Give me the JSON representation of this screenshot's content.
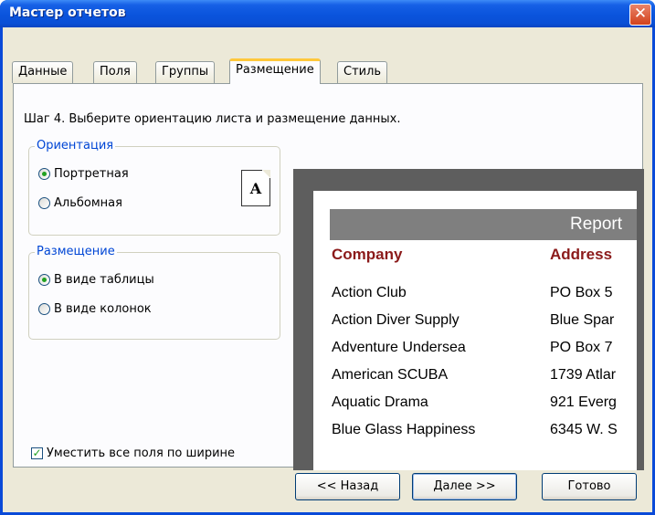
{
  "window": {
    "title": "Мастер отчетов",
    "close_symbol": "✕"
  },
  "tabs": [
    "Данные",
    "Поля",
    "Группы",
    "Размещение",
    "Стиль"
  ],
  "active_tab": "Размещение",
  "step_text": "Шаг 4. Выберите ориентацию листа и размещение данных.",
  "orientation": {
    "legend": "Ориентация",
    "options": [
      "Портретная",
      "Альбомная"
    ],
    "selected": "Портретная",
    "page_icon_letter": "A"
  },
  "layout": {
    "legend": "Размещение",
    "options": [
      "В виде таблицы",
      "В виде колонок"
    ],
    "selected": "В виде таблицы"
  },
  "fit_checkbox": {
    "label": "Уместить все поля по ширине",
    "checked": true,
    "mark": "✓"
  },
  "preview": {
    "report_title": "Report",
    "columns": [
      "Company",
      "Address"
    ],
    "rows": [
      [
        "Action Club",
        "PO Box 5"
      ],
      [
        "Action Diver Supply",
        "Blue Spar"
      ],
      [
        "Adventure Undersea",
        "PO Box 7"
      ],
      [
        "American SCUBA",
        "1739 Atlar"
      ],
      [
        "Aquatic Drama",
        "921 Everg"
      ],
      [
        "Blue Glass Happiness",
        "6345 W. S"
      ]
    ]
  },
  "buttons": {
    "back": "<< Назад",
    "next": "Далее >>",
    "finish": "Готово"
  },
  "colors": {
    "title_bar": "#0a54dc",
    "dialog_bg": "#ece9d8",
    "group_legend": "#0046d5",
    "report_header_bg": "#7f7f7f",
    "column_header": "#8b1a1a",
    "active_tab_accent": "#ffc83c"
  }
}
